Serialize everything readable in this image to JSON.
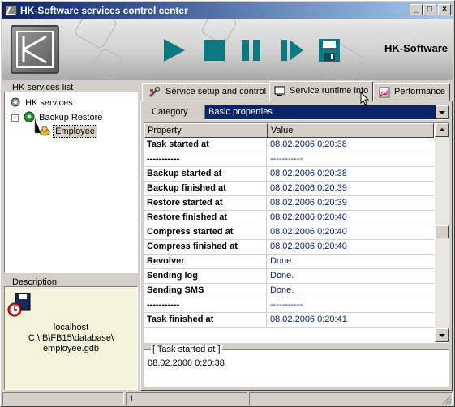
{
  "window": {
    "title": "HK-Software services control center"
  },
  "caption_buttons": {
    "minimize": "_",
    "maximize": "□",
    "close": "×"
  },
  "banner": {
    "brand": "HK-Software"
  },
  "toolbar": {
    "buttons": [
      {
        "icon": "play-icon"
      },
      {
        "icon": "stop-icon"
      },
      {
        "icon": "pause-icon"
      },
      {
        "icon": "step-icon"
      },
      {
        "icon": "save-icon"
      }
    ],
    "icon_color": "#0b7a80"
  },
  "services_panel": {
    "title": "HK services list",
    "tree": [
      {
        "label": "HK services",
        "level": 0
      },
      {
        "label": "Backup Restore",
        "level": 1,
        "expander": "−"
      },
      {
        "label": "Employee",
        "level": 2,
        "selected": true
      }
    ]
  },
  "description_panel": {
    "title": "Description",
    "lines": [
      "localhost",
      "C:\\IB\\FB15\\database\\",
      "employee.gdb"
    ]
  },
  "tabs": [
    {
      "label": "Service setup and control",
      "active": false
    },
    {
      "label": "Service runtime info",
      "active": true
    },
    {
      "label": "Performance",
      "active": false
    }
  ],
  "category": {
    "label": "Category",
    "value": "Basic properties"
  },
  "grid": {
    "columns": [
      "Property",
      "Value"
    ],
    "rows": [
      {
        "property": "Task started at",
        "value": "08.02.2006 0:20:38"
      },
      {
        "property": "-----------",
        "value": "-----------"
      },
      {
        "property": "Backup started at",
        "value": "08.02.2006 0:20:38"
      },
      {
        "property": "Backup finished at",
        "value": "08.02.2006 0:20:39"
      },
      {
        "property": "Restore started at",
        "value": "08.02.2006 0:20:39"
      },
      {
        "property": "Restore finished at",
        "value": "08.02.2006 0:20:40"
      },
      {
        "property": "Compress started at",
        "value": "08.02.2006 0:20:40"
      },
      {
        "property": "Compress finished at",
        "value": "08.02.2006 0:20:40"
      },
      {
        "property": "Revolver",
        "value": "Done."
      },
      {
        "property": "Sending log",
        "value": "Done."
      },
      {
        "property": "Sending SMS",
        "value": "Done."
      },
      {
        "property": "-----------",
        "value": "-----------"
      },
      {
        "property": "Task finished at",
        "value": "08.02.2006 0:20:41"
      }
    ]
  },
  "detail": {
    "title": "[ Task started at ]",
    "value": "08.02.2006 0:20:38"
  },
  "statusbar": {
    "panel2": "1"
  }
}
